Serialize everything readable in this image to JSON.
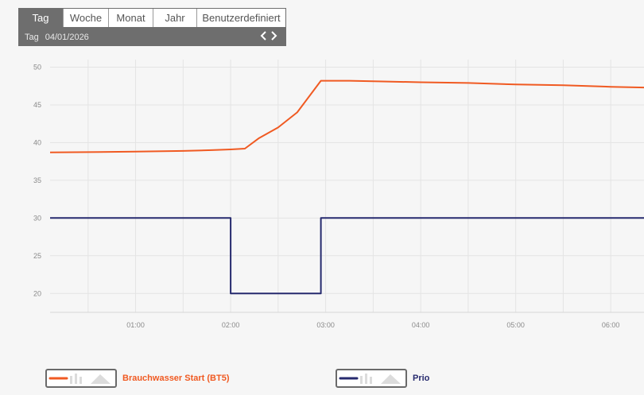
{
  "period": {
    "tabs": [
      "Tag",
      "Woche",
      "Monat",
      "Jahr",
      "Benutzerdefiniert"
    ],
    "active_tab": "Tag",
    "date_label": "Tag",
    "date_value": "04/01/2026",
    "prev_icon": "chevron-left-icon",
    "next_icon": "chevron-right-icon"
  },
  "legend": [
    {
      "label": "Brauchwasser Start (BT5)",
      "color": "#f05a22"
    },
    {
      "label": "Prio",
      "color": "#262a6e"
    }
  ],
  "chart_data": {
    "type": "line",
    "xlabel": "",
    "ylabel": "",
    "x_ticks": [
      "01:00",
      "02:00",
      "03:00",
      "04:00",
      "05:00",
      "06:00"
    ],
    "y_ticks": [
      20,
      25,
      30,
      35,
      40,
      45,
      50
    ],
    "ylim": [
      17.5,
      51
    ],
    "xlim_hours": [
      0.1,
      6.35
    ],
    "grid": true,
    "series": [
      {
        "name": "Brauchwasser Start (BT5)",
        "color": "#f05a22",
        "x": [
          0.1,
          1.0,
          1.5,
          1.8,
          2.0,
          2.15,
          2.3,
          2.5,
          2.7,
          2.95,
          3.25,
          3.6,
          4.0,
          4.5,
          5.0,
          5.5,
          6.0,
          6.35
        ],
        "y": [
          38.7,
          38.8,
          38.9,
          39.0,
          39.1,
          39.2,
          40.6,
          42.0,
          44.0,
          48.2,
          48.2,
          48.1,
          48.0,
          47.9,
          47.7,
          47.6,
          47.4,
          47.3
        ]
      },
      {
        "name": "Prio",
        "color": "#262a6e",
        "step": true,
        "x": [
          0.1,
          2.0,
          2.0,
          2.95,
          2.95,
          6.35
        ],
        "y": [
          30,
          30,
          20,
          20,
          30,
          30
        ]
      }
    ]
  }
}
